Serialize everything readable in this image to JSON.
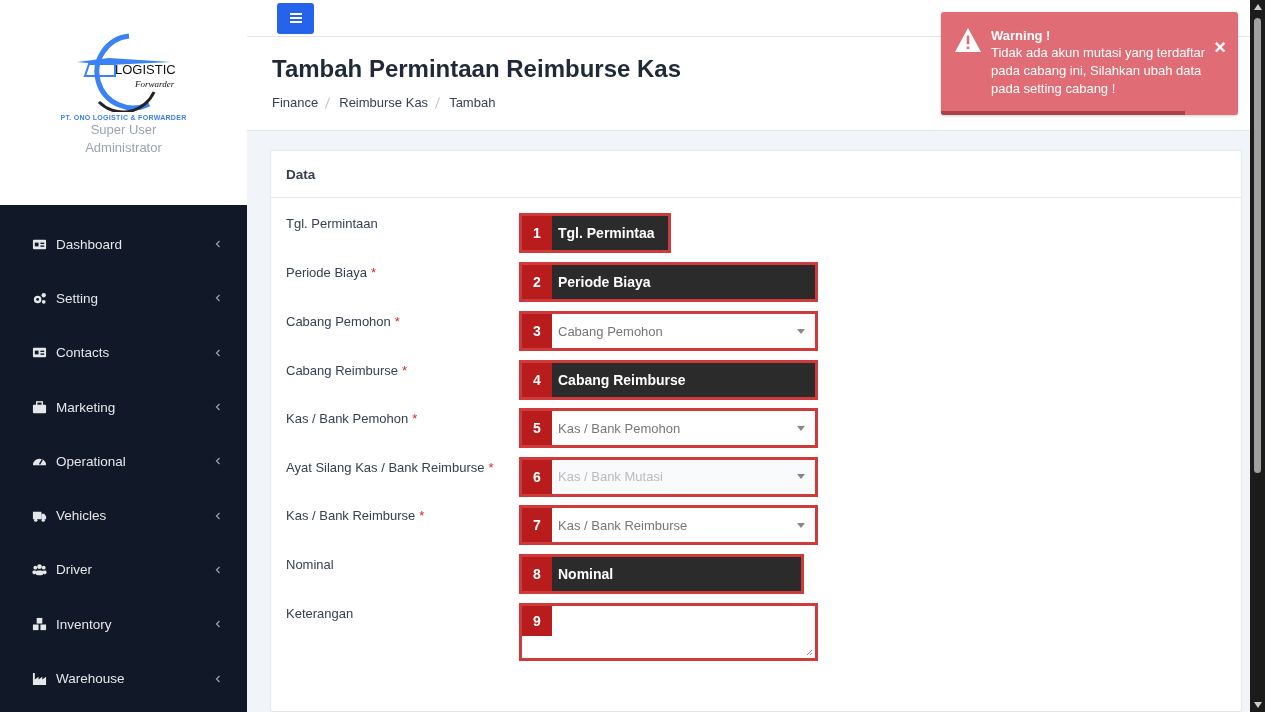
{
  "brand": {
    "logo_word": "LOGISTIC",
    "logo_sub": "Forwarder",
    "company": "PT. ONO LOGISTIC & FORWARDER",
    "user_line1": "Super User",
    "user_line2": "Administrator"
  },
  "sidebar": {
    "items": [
      {
        "label": "Dashboard",
        "expanded": false
      },
      {
        "label": "Setting",
        "expanded": false
      },
      {
        "label": "Contacts",
        "expanded": false
      },
      {
        "label": "Marketing",
        "expanded": false
      },
      {
        "label": "Operational",
        "expanded": false
      },
      {
        "label": "Vehicles",
        "expanded": false
      },
      {
        "label": "Driver",
        "expanded": false
      },
      {
        "label": "Inventory",
        "expanded": false
      },
      {
        "label": "Warehouse",
        "expanded": false
      }
    ]
  },
  "page": {
    "title": "Tambah Permintaan Reimburse Kas",
    "breadcrumb": [
      "Finance",
      "Reimburse Kas",
      "Tambah"
    ]
  },
  "card": {
    "title": "Data",
    "fields": [
      {
        "label": "Tgl. Permintaan",
        "kind": "date",
        "annotation": {
          "number": "1",
          "text": "Tgl. Permintaa"
        }
      },
      {
        "label": "Periode Biaya",
        "required_mark": "*",
        "kind": "range",
        "annotation": {
          "number": "2",
          "text": "Periode Biaya"
        }
      },
      {
        "label": "Cabang Pemohon",
        "required_mark": "*",
        "kind": "select",
        "placeholder": "Cabang Pemohon",
        "disabled": false,
        "annotation": {
          "number": "3"
        }
      },
      {
        "label": "Cabang Reimburse",
        "required_mark": "*",
        "kind": "select",
        "annotation": {
          "number": "4",
          "text": "Cabang Reimburse"
        }
      },
      {
        "label": "Kas / Bank Pemohon",
        "required_mark": "*",
        "kind": "select",
        "placeholder": "Kas / Bank Pemohon",
        "disabled": false,
        "annotation": {
          "number": "5"
        }
      },
      {
        "label": "Ayat Silang Kas / Bank Reimburse",
        "required_mark": "*",
        "kind": "select",
        "placeholder": "Kas / Bank Mutasi",
        "disabled": true,
        "annotation": {
          "number": "6"
        }
      },
      {
        "label": "Kas / Bank Reimburse",
        "required_mark": "*",
        "kind": "select",
        "placeholder": "Kas / Bank Reimburse",
        "disabled": false,
        "annotation": {
          "number": "7"
        }
      },
      {
        "label": "Nominal",
        "kind": "number",
        "annotation": {
          "number": "8",
          "text": "Nominal"
        }
      },
      {
        "label": "Keterangan",
        "kind": "textarea",
        "annotation": {
          "number": "9"
        }
      }
    ]
  },
  "toast": {
    "title": "Warning !",
    "message": "Tidak ada akun mutasi yang terdaftar pada cabang ini, Silahkan ubah data pada setting cabang !",
    "close": "×",
    "level": 0.82
  }
}
